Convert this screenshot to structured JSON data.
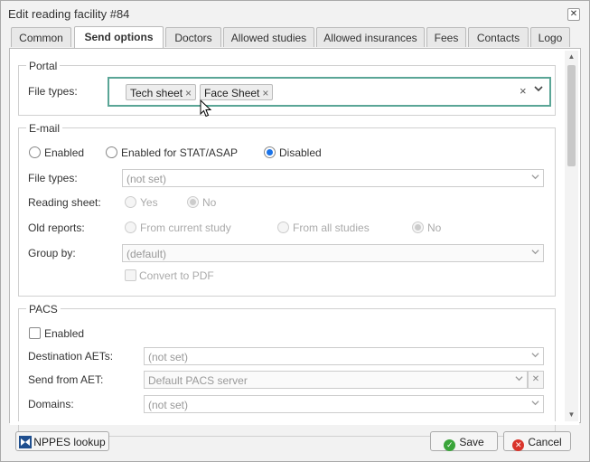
{
  "window": {
    "title": "Edit reading facility #84",
    "close": "✕"
  },
  "tabs": [
    {
      "label": "Common"
    },
    {
      "label": "Send options"
    },
    {
      "label": "Doctors"
    },
    {
      "label": "Allowed studies"
    },
    {
      "label": "Allowed insurances"
    },
    {
      "label": "Fees"
    },
    {
      "label": "Contacts"
    },
    {
      "label": "Logo"
    }
  ],
  "portal": {
    "legend": "Portal",
    "file_types_label": "File types:",
    "tags": [
      "Tech sheet",
      "Face Sheet"
    ],
    "tag_remove": "×",
    "clear": "×",
    "dropdown": "▾"
  },
  "email": {
    "legend": "E-mail",
    "mode_options": [
      "Enabled",
      "Enabled for STAT/ASAP",
      "Disabled"
    ],
    "mode_selected": "Disabled",
    "file_types_label": "File types:",
    "file_types_placeholder": "(not set)",
    "reading_sheet_label": "Reading sheet:",
    "reading_sheet_options": [
      "Yes",
      "No"
    ],
    "old_reports_label": "Old reports:",
    "old_reports_options": [
      "From current study",
      "From all studies",
      "No"
    ],
    "group_by_label": "Group by:",
    "group_by_placeholder": "(default)",
    "convert_pdf_label": "Convert to PDF"
  },
  "pacs": {
    "legend": "PACS",
    "enabled_label": "Enabled",
    "destination_label": "Destination AETs:",
    "destination_placeholder": "(not set)",
    "send_from_label": "Send from AET:",
    "send_from_placeholder": "Default PACS server",
    "send_from_clear": "✕",
    "domains_label": "Domains:",
    "domains_placeholder": "(not set)"
  },
  "footer": {
    "nppes_label": "NPPES lookup",
    "save_label": "Save",
    "cancel_label": "Cancel"
  },
  "colors": {
    "focus_border": "#5aa596",
    "radio_selected": "#1a73e8",
    "save_icon": "#3aa53a",
    "cancel_icon": "#d9342b"
  }
}
